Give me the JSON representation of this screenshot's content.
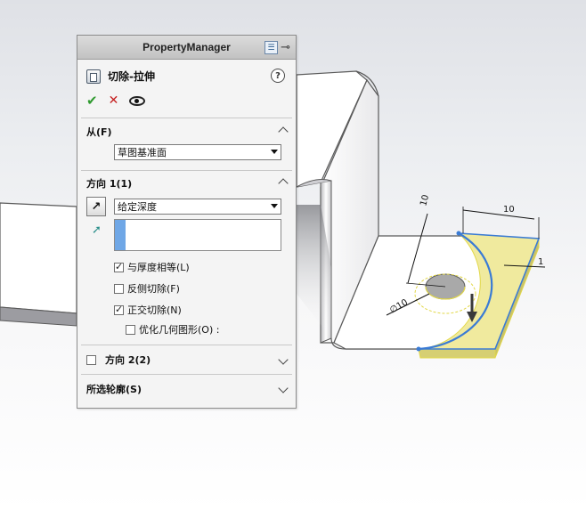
{
  "panel": {
    "title": "PropertyManager",
    "feature_name": "切除-拉伸",
    "icons": [
      "show-hide-panel-icon",
      "pin-icon",
      "cut-extrude-icon",
      "help-icon",
      "ok-checkmark-icon",
      "cancel-x-icon",
      "preview-eye-icon"
    ],
    "from_group": {
      "title": "从(F)",
      "selected": "草图基准面"
    },
    "direction1": {
      "title": "方向 1(1)",
      "end_condition": "给定深度",
      "checkboxes": [
        {
          "label": "与厚度相等(L)",
          "checked": true
        },
        {
          "label": "反侧切除(F)",
          "checked": false
        },
        {
          "label": "正交切除(N)",
          "checked": true
        },
        {
          "label": "优化几何图形(O) :",
          "checked": false
        }
      ]
    },
    "direction2": {
      "title": "方向 2(2)",
      "checked": false
    },
    "selected_contours": {
      "title": "所选轮廓(S)"
    }
  },
  "model": {
    "dimensions": [
      "10",
      "10",
      "1",
      "∅10"
    ],
    "colors": {
      "preview": "#f0ea9e",
      "sketch_blue": "#3a7bd5",
      "hole_gray": "#a9a9a9",
      "edge": "#5a5a5a"
    }
  }
}
